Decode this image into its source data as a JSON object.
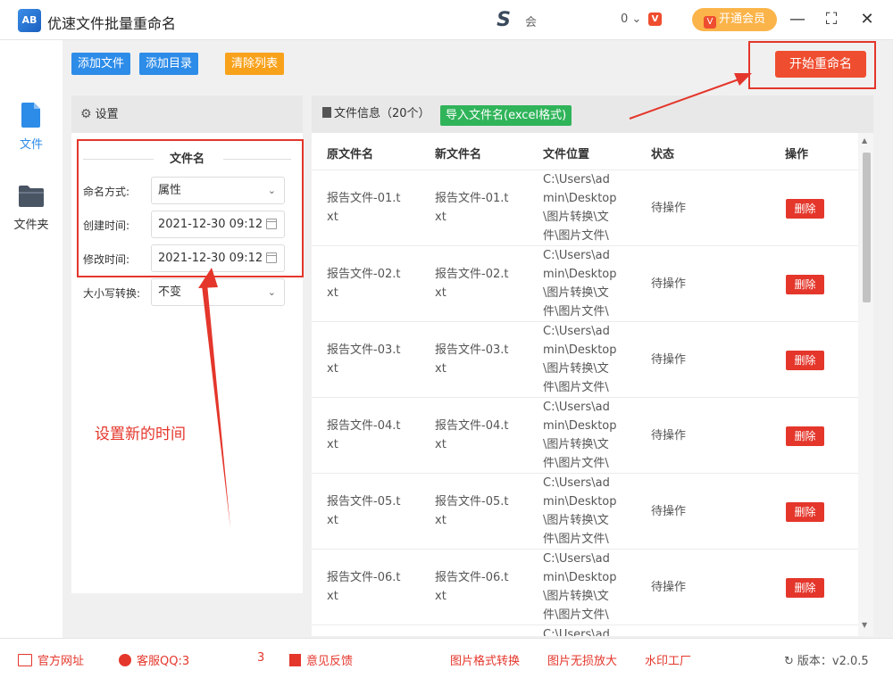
{
  "app": {
    "title": "优速文件批量重命名",
    "logo_text": "AB"
  },
  "header": {
    "user_logo": "S",
    "user_name": "会",
    "coins": "0 ⌄",
    "coin_icon": "V",
    "vip_label": "开通会员",
    "vip_icon": "V",
    "minimize": "—",
    "maximize": "⛶",
    "close": "✕"
  },
  "nav": {
    "items": [
      {
        "label": "文件",
        "icon": "file-icon"
      },
      {
        "label": "文件夹",
        "icon": "folder-icon"
      }
    ]
  },
  "toolbar": {
    "add_file": "添加文件",
    "add_dir": "添加目录",
    "clear_list": "清除列表",
    "start_rename": "开始重命名",
    "colors": {
      "blue": "#2d8ce8",
      "orange": "#f8a21c",
      "red": "#ef4d2f"
    }
  },
  "settings": {
    "title": "设置",
    "section": "文件名",
    "fields": [
      {
        "label": "命名方式:",
        "value": "属性",
        "type": "select"
      },
      {
        "label": "创建时间:",
        "value": "2021-12-30 09:12",
        "type": "date"
      },
      {
        "label": "修改时间:",
        "value": "2021-12-30 09:12",
        "type": "date"
      },
      {
        "label": "大小写转换:",
        "value": "不变",
        "type": "select"
      }
    ]
  },
  "files": {
    "title": "文件信息（20个）",
    "import_label": "导入文件名(excel格式)",
    "columns": [
      "原文件名",
      "新文件名",
      "文件位置",
      "状态",
      "操作"
    ],
    "rows": [
      {
        "orig": [
          "报告文件-01.t",
          "xt"
        ],
        "new": [
          "报告文件-01.t",
          "xt"
        ],
        "path": [
          "C:\\Users\\ad",
          "min\\Desktop",
          "\\图片转换\\文",
          "件\\图片文件\\"
        ],
        "status": "待操作",
        "action": "删除"
      },
      {
        "orig": [
          "报告文件-02.t",
          "xt"
        ],
        "new": [
          "报告文件-02.t",
          "xt"
        ],
        "path": [
          "C:\\Users\\ad",
          "min\\Desktop",
          "\\图片转换\\文",
          "件\\图片文件\\"
        ],
        "status": "待操作",
        "action": "删除"
      },
      {
        "orig": [
          "报告文件-03.t",
          "xt"
        ],
        "new": [
          "报告文件-03.t",
          "xt"
        ],
        "path": [
          "C:\\Users\\ad",
          "min\\Desktop",
          "\\图片转换\\文",
          "件\\图片文件\\"
        ],
        "status": "待操作",
        "action": "删除"
      },
      {
        "orig": [
          "报告文件-04.t",
          "xt"
        ],
        "new": [
          "报告文件-04.t",
          "xt"
        ],
        "path": [
          "C:\\Users\\ad",
          "min\\Desktop",
          "\\图片转换\\文",
          "件\\图片文件\\"
        ],
        "status": "待操作",
        "action": "删除"
      },
      {
        "orig": [
          "报告文件-05.t",
          "xt"
        ],
        "new": [
          "报告文件-05.t",
          "xt"
        ],
        "path": [
          "C:\\Users\\ad",
          "min\\Desktop",
          "\\图片转换\\文",
          "件\\图片文件\\"
        ],
        "status": "待操作",
        "action": "删除"
      },
      {
        "orig": [
          "报告文件-06.t",
          "xt"
        ],
        "new": [
          "报告文件-06.t",
          "xt"
        ],
        "path": [
          "C:\\Users\\ad",
          "min\\Desktop",
          "\\图片转换\\文",
          "件\\图片文件\\"
        ],
        "status": "待操作",
        "action": "删除"
      },
      {
        "orig": [
          "",
          ""
        ],
        "new": [
          "",
          ""
        ],
        "path": [
          "C:\\Users\\ad",
          "",
          "",
          ""
        ],
        "status": "",
        "action": ""
      }
    ]
  },
  "annotation": "设置新的时间",
  "footer": {
    "website": "官方网址",
    "support": "客服QQ:3",
    "support_tail": "3",
    "feedback": "意见反馈",
    "links": [
      "图片格式转换",
      "图片无损放大",
      "水印工厂"
    ],
    "version": "版本：v2.0.5"
  }
}
